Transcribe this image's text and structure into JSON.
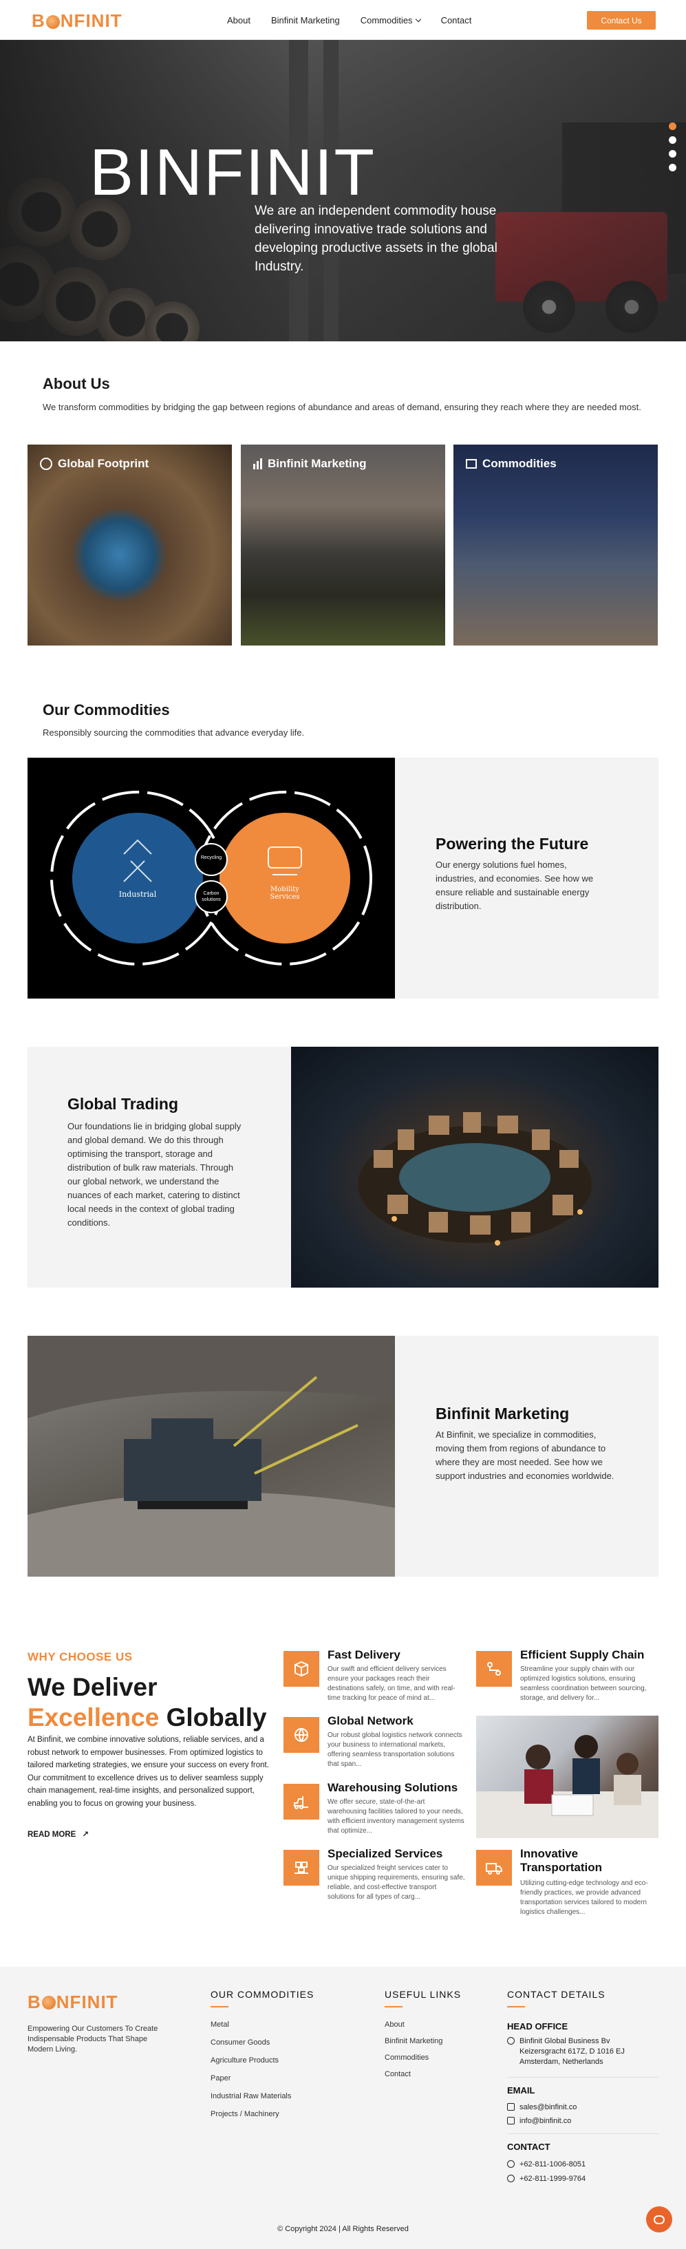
{
  "brand": {
    "name_pre": "B",
    "name_post": "NFINIT",
    "accent": "#f08a3c"
  },
  "nav": {
    "items": [
      "About",
      "Binfinit Marketing",
      "Commodities",
      "Contact"
    ],
    "cta": "Contact Us"
  },
  "hero": {
    "title": "BINFINIT",
    "text": "We are an independent commodity house delivering innovative trade solutions and developing productive assets in the global Industry.",
    "slides": 4,
    "active_slide": 1
  },
  "about": {
    "title": "About Us",
    "text": "We transform commodities by bridging the gap between regions of abundance and areas of demand, ensuring they reach where they are needed most.",
    "cards": [
      {
        "label": "Global Footprint",
        "icon": "globe-icon"
      },
      {
        "label": "Binfinit Marketing",
        "icon": "bars-icon"
      },
      {
        "label": "Commodities",
        "icon": "box-icon"
      }
    ]
  },
  "commodities": {
    "title": "Our Commodities",
    "text": "Responsibly sourcing the commodities that advance everyday life.",
    "diagram": {
      "left": "Industrial",
      "center_top": "Recycling",
      "center_bottom": "Carbon solutions",
      "right": "Mobility Services"
    },
    "panels": [
      {
        "title": "Powering the Future",
        "text": "Our energy solutions fuel homes, industries, and economies. See how we ensure reliable and sustainable energy distribution."
      },
      {
        "title": "Global Trading",
        "text": "Our foundations lie in bridging global supply and global demand. We do this through optimising the transport, storage and distribution of bulk raw materials. Through our global network, we understand the nuances of each market, catering to distinct local needs in the context of global trading conditions."
      },
      {
        "title": "Binfinit Marketing",
        "text": "At Binfinit, we specialize in commodities, moving them from regions of abundance to where they are most needed. See how we support industries and economies worldwide."
      }
    ]
  },
  "why": {
    "tag": "WHY CHOOSE US",
    "heading_1": "We Deliver",
    "heading_2a": "Excellence",
    "heading_2b": " Globally",
    "text": "At Binfinit, we combine innovative solutions, reliable services, and a robust network to empower businesses. From optimized logistics to tailored marketing strategies, we ensure your success on every front. Our commitment to excellence drives us to deliver seamless supply chain management, real-time insights, and personalized support, enabling you to focus on growing your business.",
    "read_more": "READ MORE",
    "features": [
      {
        "title": "Fast Delivery",
        "text": "Our swift and efficient delivery services ensure your packages reach their destinations safely, on time, and with real-time tracking for peace of mind at...",
        "icon": "delivery-icon"
      },
      {
        "title": "Efficient Supply Chain",
        "text": "Streamline your supply chain with our optimized logistics solutions, ensuring seamless coordination between sourcing, storage, and delivery for...",
        "icon": "route-icon"
      },
      {
        "title": "Global Network",
        "text": "Our robust global logistics network connects your business to international markets, offering seamless transportation solutions that span...",
        "icon": "network-icon"
      },
      {
        "title": "Warehousing Solutions",
        "text": "We offer secure, state-of-the-art warehousing facilities tailored to your needs, with efficient inventory management systems that optimize...",
        "icon": "forklift-icon"
      },
      {
        "title": "Specialized Services",
        "text": "Our specialized freight services cater to unique shipping requirements, ensuring safe, reliable, and cost-effective transport solutions for all types of carg...",
        "icon": "pallet-icon"
      },
      {
        "title": "Innovative Transportation",
        "text": "Utilizing cutting-edge technology and eco-friendly practices, we provide advanced transportation services tailored to modern logistics challenges...",
        "icon": "truck-icon"
      }
    ]
  },
  "footer": {
    "tagline": "Empowering Our Customers To Create Indispensable Products That Shape Modern Living.",
    "commodities_title": "OUR COMMODITIES",
    "commodities": [
      "Metal",
      "Consumer Goods",
      "Agriculture Products",
      "Paper",
      "Industrial Raw Materials",
      "Projects / Machinery"
    ],
    "links_title": "USEFUL LINKS",
    "links": [
      "About",
      "Binfinit Marketing",
      "Commodities",
      "Contact"
    ],
    "contact_title": "CONTACT DETAILS",
    "head_office_label": "HEAD OFFICE",
    "head_office": "Binfinit Global Business Bv Keizersgracht 617Z, D 1016 EJ Amsterdam, Netherlands",
    "email_label": "EMAIL",
    "emails": [
      "sales@binfinit.co",
      "info@binfinit.co"
    ],
    "contact_label": "CONTACT",
    "phones": [
      "+62-811-1006-8051",
      "+62-811-1999-9764"
    ],
    "copyright": "© Copyright 2024 | All Rights Reserved"
  }
}
